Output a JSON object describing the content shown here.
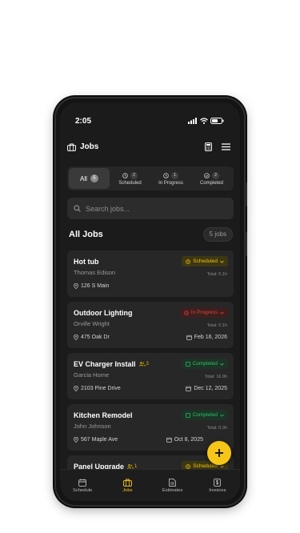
{
  "status_bar": {
    "time": "2:05"
  },
  "header": {
    "title": "Jobs"
  },
  "filter_tabs": [
    {
      "label": "All",
      "count": "5",
      "active": true,
      "icon": "none"
    },
    {
      "label": "Scheduled",
      "count": "2",
      "active": false,
      "icon": "clock-icon"
    },
    {
      "label": "In Progress",
      "count": "1",
      "active": false,
      "icon": "clock-icon"
    },
    {
      "label": "Completed",
      "count": "2",
      "active": false,
      "icon": "check-circle-icon"
    }
  ],
  "search": {
    "placeholder": "Search jobs...",
    "value": ""
  },
  "list": {
    "title": "All Jobs",
    "count_label": "5 jobs"
  },
  "jobs": [
    {
      "name": "Hot tub",
      "client": "Thomas Edison",
      "address": "126 S Main",
      "status": "Scheduled",
      "total": "Total: 0.1h",
      "date": "",
      "crew": ""
    },
    {
      "name": "Outdoor Lighting",
      "client": "Orville Wright",
      "address": "475 Oak Dr",
      "status": "In Progress",
      "total": "Total: 0.1h",
      "date": "Feb 16, 2026",
      "crew": ""
    },
    {
      "name": "EV Charger Install",
      "client": "Garcia Home",
      "address": "2103 Pine Drive",
      "status": "Completed",
      "total": "Total: 16.9h",
      "date": "Dec 12, 2025",
      "crew": "3"
    },
    {
      "name": "Kitchen Remodel",
      "client": "John Johnson",
      "address": "567 Maple Ave",
      "status": "Completed",
      "total": "Total: 0.0h",
      "date": "Oct 8, 2025",
      "crew": ""
    },
    {
      "name": "Panel Upgrade",
      "client": "",
      "address": "",
      "status": "Scheduled",
      "total": "",
      "date": "",
      "crew": "1"
    }
  ],
  "bottom_nav": [
    {
      "label": "Schedule",
      "icon": "calendar-icon",
      "active": false
    },
    {
      "label": "Jobs",
      "icon": "briefcase-icon",
      "active": true
    },
    {
      "label": "Estimates",
      "icon": "document-icon",
      "active": false
    },
    {
      "label": "Invoices",
      "icon": "invoice-dollar-icon",
      "active": false
    }
  ],
  "colors": {
    "accent": "#f5c518",
    "scheduled": "#f1c40f",
    "in_progress": "#d9453a",
    "completed": "#2fbf66",
    "card": "#272727",
    "background": "#1b1b1b"
  }
}
